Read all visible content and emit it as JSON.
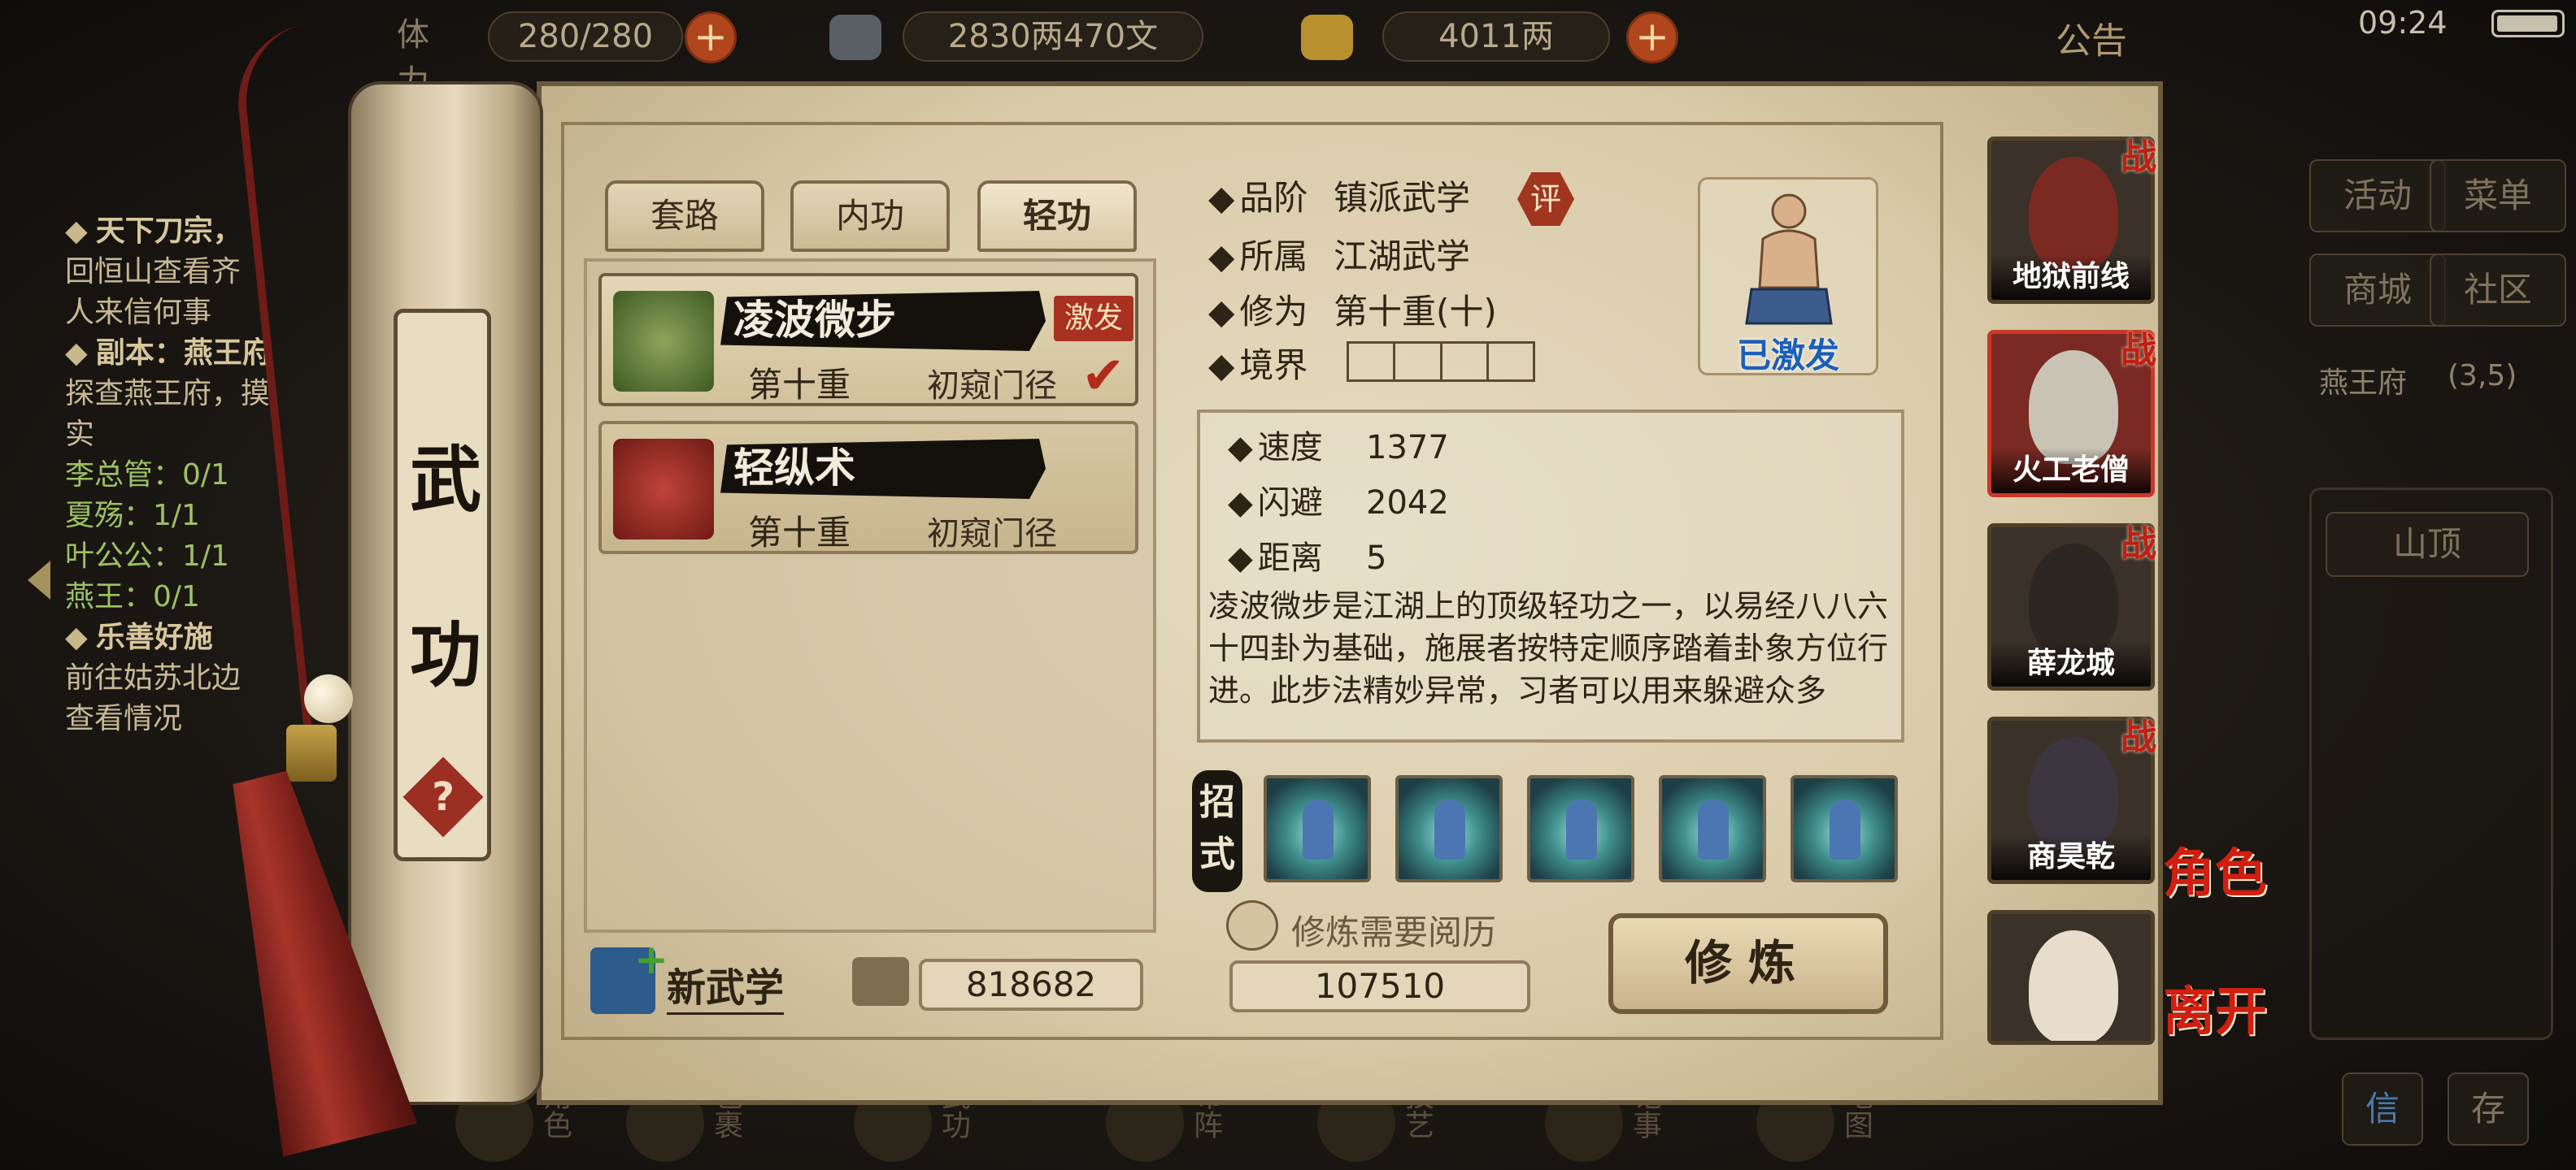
{
  "topbar": {
    "stamina_label": "体力",
    "stamina": "280/280",
    "money": "2830两470文",
    "gold": "4011两",
    "notice": "公告",
    "time": "09:24"
  },
  "quests": [
    {
      "title": "天下刀宗，",
      "lines": [
        "回恒山查看齐",
        "人来信何事"
      ]
    },
    {
      "title": "副本：燕王府",
      "lines": [
        "探查燕王府，摸",
        "实"
      ],
      "progress": [
        "李总管：0/1",
        "夏殇：1/1",
        "叶公公：1/1",
        "燕王：0/1"
      ]
    },
    {
      "title": "乐善好施",
      "lines": [
        "前往姑苏北边",
        "查看情况"
      ]
    }
  ],
  "right_menu": {
    "activity": "活动",
    "menu": "菜单",
    "shop": "商城",
    "community": "社区",
    "location": "燕王府",
    "coords": "(3,5)",
    "map_button": "山顶",
    "mail": "信",
    "save": "存"
  },
  "bottom_nav": [
    {
      "label": "角色",
      "icon": "character-icon"
    },
    {
      "label": "包裹",
      "icon": "bag-icon"
    },
    {
      "label": "武功",
      "icon": "martial-arts-icon"
    },
    {
      "label": "布阵",
      "icon": "formation-icon"
    },
    {
      "label": "技艺",
      "icon": "craft-icon"
    },
    {
      "label": "记事",
      "icon": "journal-icon"
    },
    {
      "label": "地图",
      "icon": "map-icon"
    }
  ],
  "scroll_title": [
    "武",
    "功"
  ],
  "help": "?",
  "tabs": [
    {
      "label": "套路",
      "active": false
    },
    {
      "label": "内功",
      "active": false
    },
    {
      "label": "轻功",
      "active": true
    }
  ],
  "skills": [
    {
      "name": "凌波微步",
      "level": "第十重",
      "stage": "初窥门径",
      "tag": "激发",
      "selected": true
    },
    {
      "name": "轻纵术",
      "level": "第十重",
      "stage": "初窥门径",
      "tag": "",
      "selected": false
    }
  ],
  "new_skill": "新武学",
  "points": "818682",
  "detail": {
    "grade_label": "品阶",
    "grade": "镇派武学",
    "grade_badge": "评",
    "belong_label": "所属",
    "belong": "江湖武学",
    "cultivation_label": "修为",
    "cultivation": "第十重(十)",
    "realm_label": "境界",
    "activated": "已激发",
    "stats": [
      {
        "label": "速度",
        "value": "1377"
      },
      {
        "label": "闪避",
        "value": "2042"
      },
      {
        "label": "距离",
        "value": "5"
      }
    ],
    "description": "凌波微步是江湖上的顶级轻功之一，以易经八八六十四卦为基础，施展者按特定顺序踏着卦象方位行进。此步法精妙异常，习者可以用来躲避众多"
  },
  "moves_label": [
    "招",
    "式"
  ],
  "moves_count": 5,
  "cost_label": "修炼需要阅历",
  "cost": "107510",
  "train_button": "修炼",
  "characters": [
    {
      "name": "地狱前线",
      "badge": "战"
    },
    {
      "name": "火工老僧",
      "badge": "战",
      "selected": true
    },
    {
      "name": "薛龙城",
      "badge": "战"
    },
    {
      "name": "商昊乾",
      "badge": "战"
    },
    {
      "name": "",
      "badge": ""
    }
  ],
  "side_buttons": {
    "role": "角色",
    "leave": "离开"
  },
  "colors": {
    "accent_red": "#c8382a",
    "activated_blue": "#1b5fb8",
    "parchment": "#e7dcc2"
  }
}
